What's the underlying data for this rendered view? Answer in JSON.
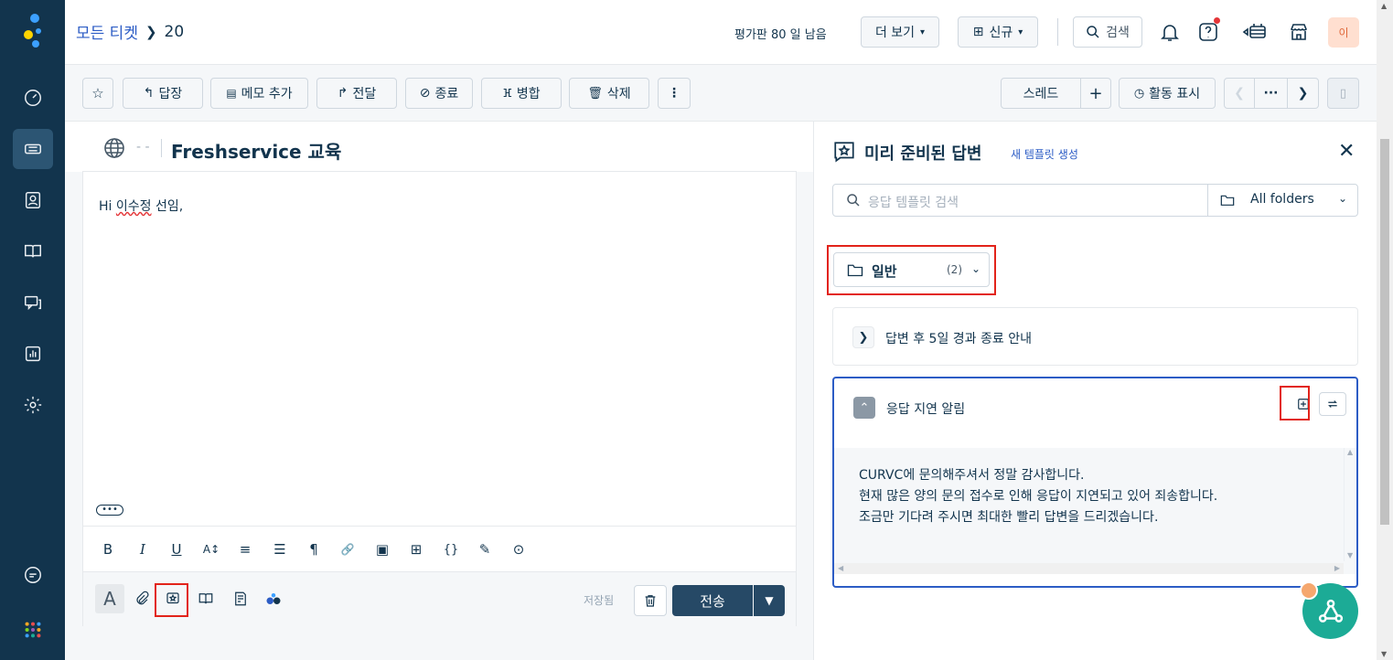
{
  "breadcrumb": {
    "root": "모든 티켓",
    "ticket_number": "20"
  },
  "header": {
    "eval_notice": "평가판 80 일 남음",
    "more_label": "더 보기",
    "new_label": "신규",
    "search_label": "검색",
    "avatar_initial": "이"
  },
  "toolbar": {
    "reply": "답장",
    "add_note": "메모 추가",
    "forward": "전달",
    "close": "종료",
    "merge": "병합",
    "delete": "삭제",
    "more": "⋮",
    "thread": "스레드",
    "plus": "+",
    "show_activity": "활동 표시",
    "ellipsis": "···"
  },
  "ticket": {
    "subject": "Freshservice 교육",
    "dashes": "- -"
  },
  "editor": {
    "greeting_prefix": "Hi ",
    "greeting_name": "이수정",
    "greeting_suffix": " 선임,",
    "saved_label": "저장됨",
    "send_label": "전송"
  },
  "formatting": [
    "B",
    "I",
    "U",
    "A↕",
    "≡",
    "☰",
    "¶",
    "🔗",
    "▣",
    "⊞",
    "{}",
    "✎",
    "⊙"
  ],
  "canned": {
    "title": "미리 준비된 답변",
    "new_template": "새 템플릿 생성",
    "search_placeholder": "응답 템플릿 검색",
    "folder_filter": "All folders",
    "category": {
      "name": "일반",
      "count": "(2)"
    },
    "items": [
      {
        "title": "답변 후 5일 경과 종료 안내"
      },
      {
        "title": "응답 지연 알림"
      }
    ],
    "body_lines": [
      "CURVC에 문의해주셔서 정말 감사합니다.",
      "현재 많은 양의 문의 접수로 인해 응답이 지연되고 있어 죄송합니다.",
      "조금만 기다려 주시면 최대한 빨리 답변을 드리겠습니다."
    ]
  },
  "colors": {
    "sidebar": "#12344d",
    "accent": "#2c5cc5",
    "send": "#264966",
    "highlight": "#e2231a",
    "fab": "#1cab96"
  }
}
